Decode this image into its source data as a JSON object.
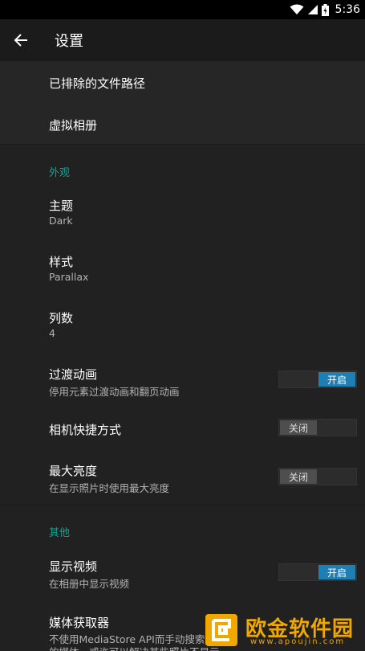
{
  "status_bar": {
    "time": "5:36"
  },
  "toolbar": {
    "title": "设置"
  },
  "top_group": [
    {
      "label": "已排除的文件路径"
    },
    {
      "label": "虚拟相册"
    }
  ],
  "appearance": {
    "header": "外观",
    "theme": {
      "label": "主题",
      "value": "Dark"
    },
    "style": {
      "label": "样式",
      "value": "Parallax"
    },
    "columns": {
      "label": "列数",
      "value": "4"
    },
    "transition": {
      "label": "过渡动画",
      "sub": "停用元素过渡动画和翻页动画",
      "state": "开启"
    },
    "camera_shortcut": {
      "label": "相机快捷方式",
      "state": "关闭"
    },
    "max_brightness": {
      "label": "最大亮度",
      "sub": "在显示照片时使用最大亮度",
      "state": "关闭"
    }
  },
  "other": {
    "header": "其他",
    "show_videos": {
      "label": "显示视频",
      "sub": "在相册中显示视频",
      "state": "开启"
    },
    "media_retriever": {
      "label": "媒体获取器",
      "sub1": "不使用MediaStore API而手动搜索文件中",
      "sub2": "的媒体，或许可以解决某些照片不显示"
    }
  },
  "watermark": {
    "text": "欧金软件园",
    "url": "www.apoujin.com"
  },
  "colors": {
    "accent": "#1f9e8e",
    "switch_on": "#1f7fb4",
    "background": "#212121"
  }
}
